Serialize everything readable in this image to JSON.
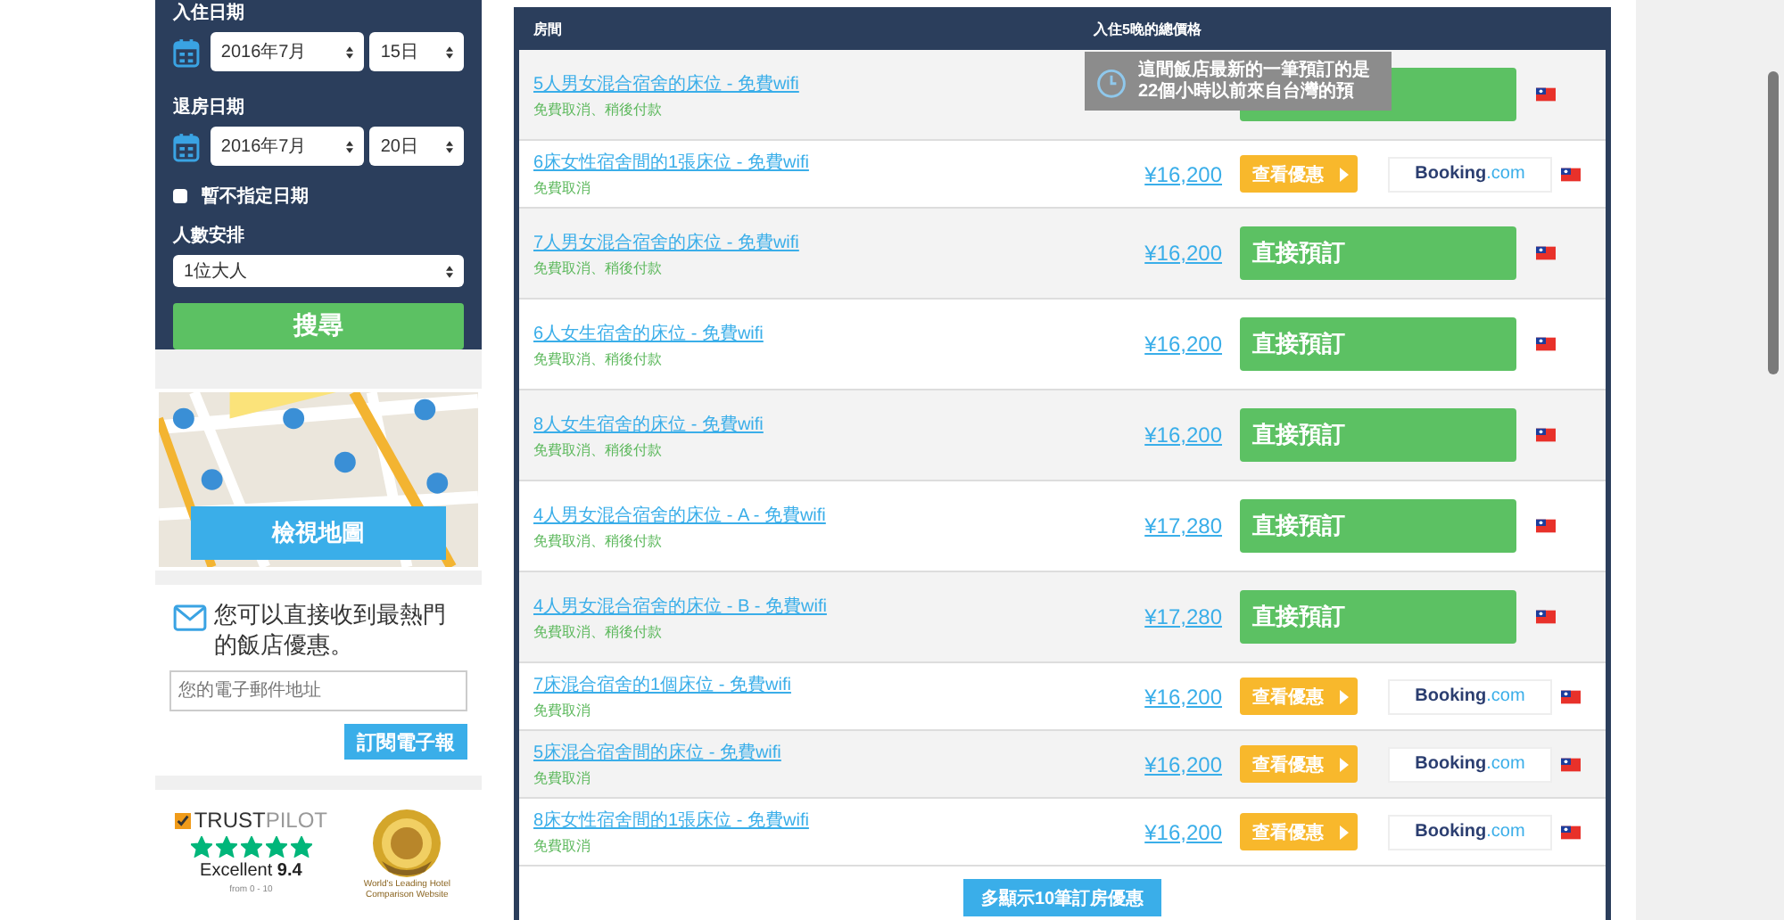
{
  "search_form": {
    "checkin_label": "入住日期",
    "checkin_month": "2016年7月",
    "checkin_day": "15日",
    "checkout_label": "退房日期",
    "checkout_month": "2016年7月",
    "checkout_day": "20日",
    "no_dates": {
      "label": "暫不指定日期",
      "checked": false
    },
    "guests_label": "人數安排",
    "guests": "1位大人",
    "search_button": "搜尋"
  },
  "map": {
    "button": "檢視地圖"
  },
  "newsletter": {
    "title": "您可以直接收到最熱門的飯店優惠。",
    "placeholder": "您的電子郵件地址",
    "button": "訂閱電子報"
  },
  "awards": {
    "logo_strong": "TRUST",
    "logo_light": "PILOT",
    "stars": 5,
    "rating_label": "Excellent",
    "rating": "9.4",
    "range": "from 0 - 10",
    "award_caption": "World's Leading Hotel Comparison Website"
  },
  "rooms": {
    "columns": [
      "房間",
      "入住5晚的總價格"
    ],
    "rows": [
      {
        "kind": "direct",
        "name": "5人男女混合宿舍的床位 - 免費wifi",
        "terms": "免費取消、稍後付款"
      },
      {
        "kind": "partner",
        "name": "6床女性宿舍間的1張床位 - 免費wifi",
        "terms": "免費取消",
        "price": "¥16,200",
        "button": "查看優惠",
        "partner": "Booking",
        "partner_suffix": ".com"
      },
      {
        "kind": "direct",
        "name": "7人男女混合宿舍的床位 - 免費wifi",
        "terms": "免費取消、稍後付款",
        "price": "¥16,200",
        "button": "直接預訂"
      },
      {
        "kind": "direct",
        "name": "6人女生宿舍的床位 - 免費wifi",
        "terms": "免費取消、稍後付款",
        "price": "¥16,200",
        "button": "直接預訂"
      },
      {
        "kind": "direct",
        "name": "8人女生宿舍的床位 - 免費wifi",
        "terms": "免費取消、稍後付款",
        "price": "¥16,200",
        "button": "直接預訂"
      },
      {
        "kind": "direct",
        "name": "4人男女混合宿舍的床位 - A - 免費wifi",
        "terms": "免費取消、稍後付款",
        "price": "¥17,280",
        "button": "直接預訂"
      },
      {
        "kind": "direct",
        "name": "4人男女混合宿舍的床位 - B - 免費wifi",
        "terms": "免費取消、稍後付款",
        "price": "¥17,280",
        "button": "直接預訂"
      },
      {
        "kind": "partner",
        "name": "7床混合宿舍的1個床位 - 免費wifi",
        "terms": "免費取消",
        "price": "¥16,200",
        "button": "查看優惠",
        "partner": "Booking",
        "partner_suffix": ".com"
      },
      {
        "kind": "partner",
        "name": "5床混合宿舍間的床位 - 免費wifi",
        "terms": "免費取消",
        "price": "¥16,200",
        "button": "查看優惠",
        "partner": "Booking",
        "partner_suffix": ".com"
      },
      {
        "kind": "partner",
        "name": "8床女性宿舍間的1張床位 - 免費wifi",
        "terms": "免費取消",
        "price": "¥16,200",
        "button": "查看優惠",
        "partner": "Booking",
        "partner_suffix": ".com"
      }
    ],
    "more_button": "多顯示10筆訂房優惠"
  },
  "tooltip": {
    "lines": [
      "這間飯店最新的一筆預訂的是",
      "22個小時以前來自台灣的預"
    ]
  }
}
